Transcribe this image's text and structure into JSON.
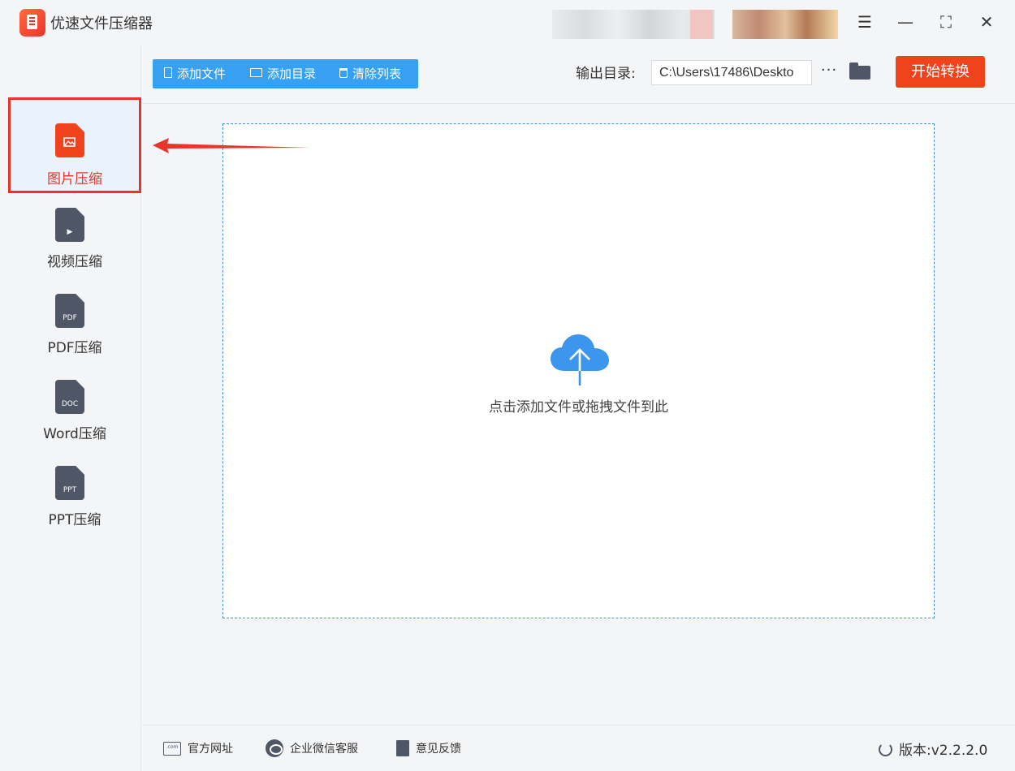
{
  "window": {
    "title": "优速文件压缩器",
    "menu_icon": "☰",
    "minimize_icon": "—",
    "maximize_icon": "⛶",
    "close_icon": "✕"
  },
  "sidebar": {
    "items": [
      {
        "label": "图片压缩",
        "icon": "image-file-icon",
        "active": true
      },
      {
        "label": "视频压缩",
        "icon": "video-file-icon",
        "badge": "▶"
      },
      {
        "label": "PDF压缩",
        "icon": "pdf-file-icon",
        "badge": "PDF"
      },
      {
        "label": "Word压缩",
        "icon": "doc-file-icon",
        "badge": "DOC"
      },
      {
        "label": "PPT压缩",
        "icon": "ppt-file-icon",
        "badge": "PPT"
      }
    ]
  },
  "toolbar": {
    "add_file": "添加文件",
    "add_folder": "添加目录",
    "clear_list": "清除列表",
    "output_label": "输出目录:",
    "output_path": "C:\\Users\\17486\\Deskto",
    "more": "···",
    "start": "开始转换"
  },
  "dropzone": {
    "hint": "点击添加文件或拖拽文件到此"
  },
  "footer": {
    "website": "官方网址",
    "website_icon_text": ".com",
    "wechat_support": "企业微信客服",
    "feedback": "意见反馈",
    "version": "版本:v2.2.2.0"
  },
  "colors": {
    "accent_blue": "#37a0f0",
    "start_orange": "#f0421d",
    "highlight_red": "#e8352c",
    "icon_gray": "#4f5666"
  }
}
